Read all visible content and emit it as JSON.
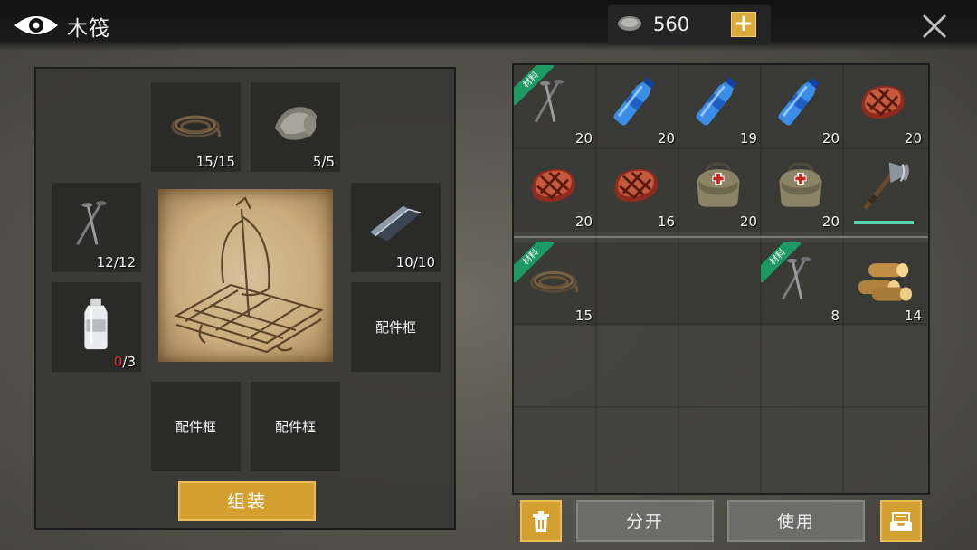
{
  "header": {
    "title": "木筏",
    "currency": "560",
    "plus_label": "+"
  },
  "craft": {
    "slots": {
      "rope": {
        "count": "15/15"
      },
      "cloth": {
        "count": "5/5"
      },
      "nails": {
        "count": "12/12"
      },
      "metal": {
        "count": "10/10"
      },
      "bottle": {
        "have": "0",
        "need": "/3"
      },
      "accessory_right": {
        "label": "配件框"
      },
      "accessory_bottom_left": {
        "label": "配件框"
      },
      "accessory_bottom_right": {
        "label": "配件框"
      }
    },
    "assemble_label": "组装"
  },
  "inventory": {
    "material_tag": "材料",
    "items": [
      {
        "icon": "nails-icon",
        "count": "20",
        "tag": true
      },
      {
        "icon": "water-bottle-icon",
        "count": "20"
      },
      {
        "icon": "water-bottle-icon",
        "count": "19"
      },
      {
        "icon": "water-bottle-icon",
        "count": "20"
      },
      {
        "icon": "steak-icon",
        "count": "20"
      },
      {
        "icon": "steak-icon",
        "count": "20"
      },
      {
        "icon": "steak-icon",
        "count": "16"
      },
      {
        "icon": "medical-bag-icon",
        "count": "20"
      },
      {
        "icon": "medical-bag-icon",
        "count": "20"
      },
      {
        "icon": "hatchet-icon",
        "count": "",
        "durability": 1.0
      },
      {
        "icon": "rope-icon",
        "count": "15",
        "tag": true
      },
      {
        "icon": "nails-icon",
        "count": "8",
        "tag": true
      },
      {
        "icon": "logs-icon",
        "count": "14"
      }
    ]
  },
  "actions": {
    "split_label": "分开",
    "use_label": "使用"
  },
  "colors": {
    "accent": "#d4a030",
    "tag": "#1d9a63",
    "durability": "#59d2b0",
    "missing": "#e33333"
  }
}
